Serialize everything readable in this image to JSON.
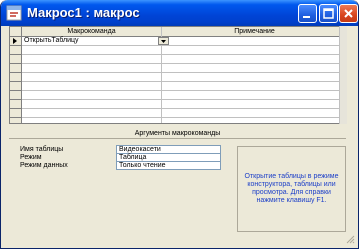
{
  "window": {
    "title": "Макрос1 : макрос"
  },
  "grid": {
    "columns": [
      "Макрокоманда",
      "Примечание"
    ],
    "rows": [
      {
        "action": "ОткрытьТаблицу",
        "note": ""
      }
    ]
  },
  "args": {
    "title": "Аргументы макрокоманды",
    "fields": [
      {
        "label": "Имя таблицы",
        "value": "Видеокасети"
      },
      {
        "label": "Режим",
        "value": "Таблица"
      },
      {
        "label": "Режим данных",
        "value": "Только чтение"
      }
    ],
    "help": "Открытие таблицы в режиме конструктора, таблицы или просмотра. Для справки нажмите клавишу F1."
  },
  "colors": {
    "titlebar": "#0046d5",
    "help_text": "#1c3fc8"
  }
}
